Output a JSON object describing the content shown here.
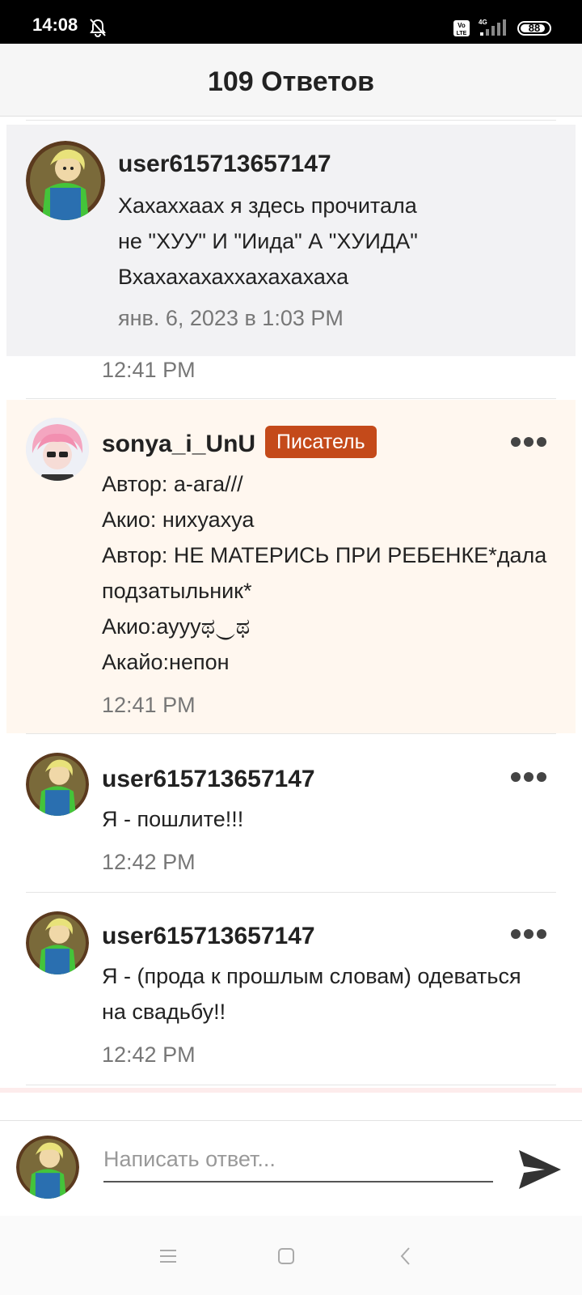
{
  "status_bar": {
    "time": "14:08",
    "battery": "88",
    "network": "4G",
    "volte": "Vo LTE"
  },
  "header": {
    "title": "109 Ответов"
  },
  "parent_comment": {
    "username": "user615713657147",
    "text": "Хахаххаах я здесь прочитала\nне \"ХУУ\" И \"Иида\" А \"ХУИДА\"\nВхахахахаххахахахаха",
    "date": "янв. 6, 2023 в 1:03 PM"
  },
  "replies": [
    {
      "time": "12:41 PM"
    },
    {
      "username": "sonya_i_UnU",
      "badge": "Писатель",
      "text": "Автор: а-ага///\nАкио: нихуахуа\nАвтор: НЕ МАТЕРИСЬ ПРИ РЕБЕНКЕ*дала\nподзатыльник*\nАкио:ауууಥ‿ಥ\nАкайо:непон",
      "time": "12:41 PM"
    },
    {
      "username": "user615713657147",
      "text": "Я - пошлите!!!",
      "time": "12:42 PM"
    },
    {
      "username": "user615713657147",
      "text": "Я - (прода к прошлым словам) одеваться\nна свадьбу!!",
      "time": "12:42 PM"
    }
  ],
  "reply_box": {
    "placeholder": "Написать ответ..."
  },
  "colors": {
    "badge": "#c44a1a",
    "writer_bg": "#fff7ef",
    "parent_bg": "#f2f2f4"
  },
  "icons": {
    "more": "more-dots-icon",
    "send": "send-icon",
    "bell": "bell-muted-icon",
    "nav": [
      "menu-icon",
      "home-square-icon",
      "back-chevron-icon"
    ]
  }
}
